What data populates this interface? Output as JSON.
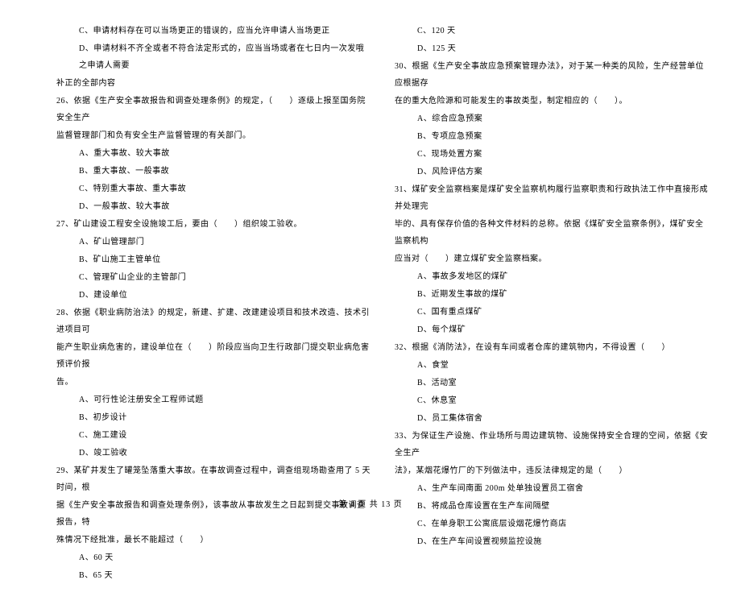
{
  "left_column": [
    {
      "cls": "indent-1",
      "text": "C、申请材料存在可以当场更正的错误的，应当允许申请人当场更正"
    },
    {
      "cls": "indent-1",
      "text": "D、申请材料不齐全或者不符合法定形式的，应当当场或者在七日内一次发哦之申请人需要"
    },
    {
      "cls": "",
      "text": "补正的全部内容"
    },
    {
      "cls": "",
      "text": "26、依据《生产安全事故报告和调查处理条例》的规定，（　　）逐级上报至国务院安全生产"
    },
    {
      "cls": "",
      "text": "监督管理部门和负有安全生产监督管理的有关部门。"
    },
    {
      "cls": "indent-1",
      "text": "A、重大事故、较大事故"
    },
    {
      "cls": "indent-1",
      "text": "B、重大事故、一般事故"
    },
    {
      "cls": "indent-1",
      "text": "C、特别重大事故、重大事故"
    },
    {
      "cls": "indent-1",
      "text": "D、一般事故、较大事故"
    },
    {
      "cls": "",
      "text": "27、矿山建设工程安全设施竣工后，要由（　　）组织竣工验收。"
    },
    {
      "cls": "indent-1",
      "text": "A、矿山管理部门"
    },
    {
      "cls": "indent-1",
      "text": "B、矿山施工主管单位"
    },
    {
      "cls": "indent-1",
      "text": "C、管理矿山企业的主管部门"
    },
    {
      "cls": "indent-1",
      "text": "D、建设单位"
    },
    {
      "cls": "",
      "text": "28、依据《职业病防治法》的规定，新建、扩建、改建建设项目和技术改造、技术引进项目可"
    },
    {
      "cls": "",
      "text": "能产生职业病危害的，建设单位在（　　）阶段应当向卫生行政部门提交职业病危害预评价报"
    },
    {
      "cls": "",
      "text": "告。"
    },
    {
      "cls": "indent-1",
      "text": "A、可行性论注册安全工程师试题"
    },
    {
      "cls": "indent-1",
      "text": "B、初步设计"
    },
    {
      "cls": "indent-1",
      "text": "C、施工建设"
    },
    {
      "cls": "indent-1",
      "text": "D、竣工验收"
    },
    {
      "cls": "",
      "text": "29、某矿井发生了罐笼坠落重大事故。在事故调查过程中，调查组现场勘查用了 5 天时间，根"
    },
    {
      "cls": "",
      "text": "据《生产安全事故报告和调查处理条例》，该事故从事故发生之日起到提交事故调查报告，特"
    },
    {
      "cls": "",
      "text": "殊情况下经批准，最长不能超过（　　）"
    },
    {
      "cls": "indent-1",
      "text": "A、60 天"
    },
    {
      "cls": "indent-1",
      "text": "B、65 天"
    }
  ],
  "right_column": [
    {
      "cls": "indent-1",
      "text": "C、120 天"
    },
    {
      "cls": "indent-1",
      "text": "D、125 天"
    },
    {
      "cls": "",
      "text": "30、根据《生产安全事故应急预案管理办法》，对于某一种类的风险，生产经营单位应根据存"
    },
    {
      "cls": "",
      "text": "在的重大危险源和可能发生的事故类型，制定相应的（　　）。"
    },
    {
      "cls": "indent-1",
      "text": "A、综合应急预案"
    },
    {
      "cls": "indent-1",
      "text": "B、专项应急预案"
    },
    {
      "cls": "indent-1",
      "text": "C、现场处置方案"
    },
    {
      "cls": "indent-1",
      "text": "D、风险评估方案"
    },
    {
      "cls": "",
      "text": "31、煤矿安全监察档案是煤矿安全监察机构履行监察职责和行政执法工作中直接形成并处理完"
    },
    {
      "cls": "",
      "text": "毕的、具有保存价值的各种文件材料的总称。依据《煤矿安全监察条例》，煤矿安全监察机构"
    },
    {
      "cls": "",
      "text": "应当对（　　）建立煤矿安全监察档案。"
    },
    {
      "cls": "indent-1",
      "text": "A、事故多发地区的煤矿"
    },
    {
      "cls": "indent-1",
      "text": "B、近期发生事故的煤矿"
    },
    {
      "cls": "indent-1",
      "text": "C、国有重点煤矿"
    },
    {
      "cls": "indent-1",
      "text": "D、每个煤矿"
    },
    {
      "cls": "",
      "text": "32、根据《消防法》，在设有车间或者仓库的建筑物内，不得设置（　　）"
    },
    {
      "cls": "indent-1",
      "text": "A、食堂"
    },
    {
      "cls": "indent-1",
      "text": "B、活动室"
    },
    {
      "cls": "indent-1",
      "text": "C、休息室"
    },
    {
      "cls": "indent-1",
      "text": "D、员工集体宿舍"
    },
    {
      "cls": "",
      "text": "33、为保证生产设施、作业场所与周边建筑物、设施保持安全合理的空间，依据《安全生产"
    },
    {
      "cls": "",
      "text": "法》，某烟花爆竹厂的下列做法中，违反法律规定的是（　　）"
    },
    {
      "cls": "indent-1",
      "text": "A、生产车间南面 200m 处单独设置员工宿舍"
    },
    {
      "cls": "indent-1",
      "text": "B、将成品仓库设置在生产车间隔壁"
    },
    {
      "cls": "indent-1",
      "text": "C、在单身职工公寓底层设烟花爆竹商店"
    },
    {
      "cls": "indent-1",
      "text": "D、在生产车间设置视频监控设施"
    }
  ],
  "footer": "第 4 页 共 13 页"
}
